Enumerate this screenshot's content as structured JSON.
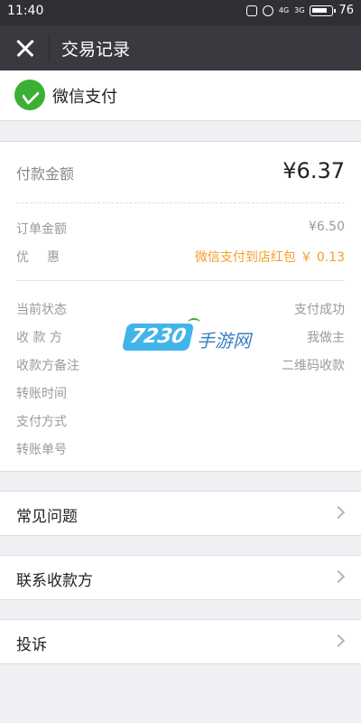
{
  "status_bar": {
    "time": "11:40",
    "signal_1": "4G",
    "signal_2": "3G",
    "battery": "76"
  },
  "nav": {
    "title": "交易记录",
    "close_icon": "close-icon"
  },
  "merchant": {
    "name": "微信支付",
    "logo": "wechat-pay-icon",
    "logo_color": "#3cb034"
  },
  "payment": {
    "amount_label": "付款金额",
    "amount": "¥6.37",
    "rows_price": [
      {
        "label": "订单金额",
        "value": "¥6.50"
      },
      {
        "label": "优惠",
        "value": "微信支付到店红包 ￥ 0.13"
      }
    ],
    "rows_info": [
      {
        "label": "当前状态",
        "value": "支付成功"
      },
      {
        "label": "收 款 方",
        "value": "我做主"
      },
      {
        "label": "收款方备注",
        "value": "二维码收款"
      },
      {
        "label": "转账时间",
        "value": ""
      },
      {
        "label": "支付方式",
        "value": ""
      },
      {
        "label": "转账单号",
        "value": ""
      }
    ],
    "discount_color": "#f0a12a"
  },
  "watermark": {
    "number": "7230",
    "text": "手游网"
  },
  "menu": [
    {
      "label": "常见问题"
    },
    {
      "label": "联系收款方"
    },
    {
      "label": "投诉"
    }
  ]
}
